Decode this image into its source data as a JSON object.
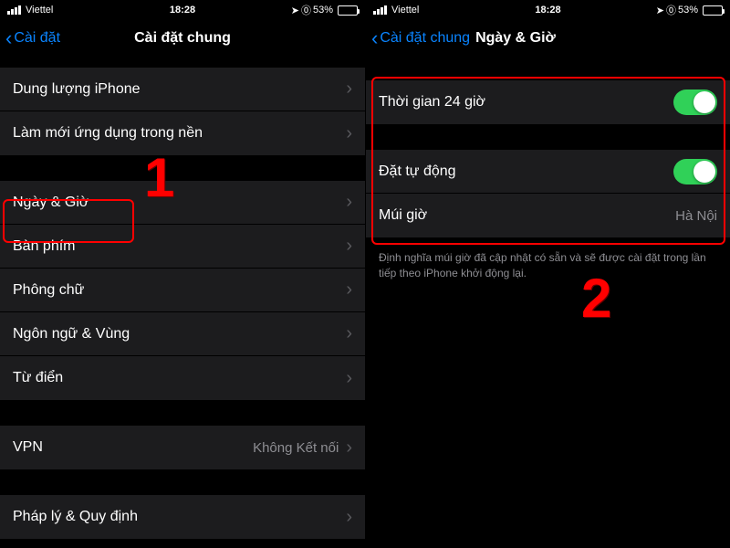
{
  "status": {
    "carrier": "Viettel",
    "time": "18:28",
    "alarm_icon": "⏰",
    "battery_text": "53%",
    "battery_level": 53
  },
  "left": {
    "back_label": "Cài đặt",
    "title": "Cài đặt chung",
    "group1": [
      {
        "label": "Dung lượng iPhone"
      },
      {
        "label": "Làm mới ứng dụng trong nền"
      }
    ],
    "group2": [
      {
        "label": "Ngày & Giờ"
      },
      {
        "label": "Bàn phím"
      },
      {
        "label": "Phông chữ"
      },
      {
        "label": "Ngôn ngữ & Vùng"
      },
      {
        "label": "Từ điển"
      }
    ],
    "group3": [
      {
        "label": "VPN",
        "value": "Không Kết nối"
      }
    ],
    "group4": [
      {
        "label": "Pháp lý & Quy định"
      }
    ],
    "step_number": "1"
  },
  "right": {
    "back_label": "Cài đặt chung",
    "title": "Ngày & Giờ",
    "group1": [
      {
        "label": "Thời gian 24 giờ",
        "toggle": true
      }
    ],
    "group2": [
      {
        "label": "Đặt tự động",
        "toggle": true
      },
      {
        "label": "Múi giờ",
        "value": "Hà Nội"
      }
    ],
    "footer": "Định nghĩa múi giờ đã cập nhật có sẵn và sẽ được cài đặt trong lần tiếp theo iPhone khởi động lại.",
    "step_number": "2"
  }
}
